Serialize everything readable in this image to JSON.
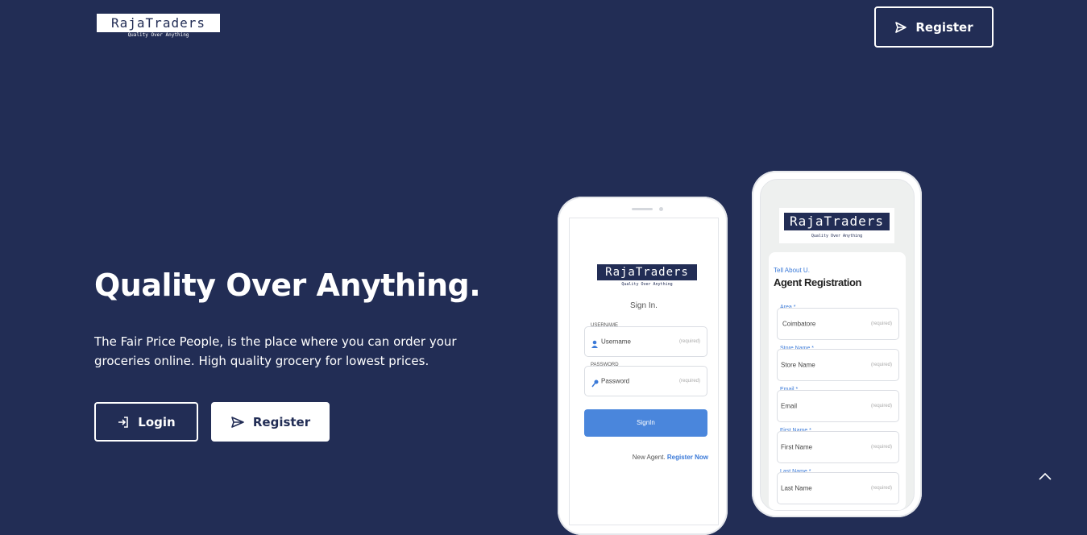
{
  "header": {
    "logo_word": "RajaTraders",
    "logo_tagline": "Quality Over Anything",
    "register_label": "Register"
  },
  "hero": {
    "title": "Quality Over Anything.",
    "description": "The Fair Price People, is the place where you can order your groceries online. High quality grocery for lowest prices.",
    "login_label": "Login",
    "register_label": "Register"
  },
  "phone_signin": {
    "logo_word": "RajaTraders",
    "logo_tagline": "Quality Over Anything",
    "heading": "Sign In.",
    "username_label": "USERNAME",
    "username_placeholder": "Username",
    "password_label": "PASSWORD",
    "password_placeholder": "Password",
    "required_hint": "(required)",
    "signin_button": "SignIn",
    "new_agent_text": "New Agent.",
    "register_now_link": "Register Now"
  },
  "phone_register": {
    "logo_word": "RajaTraders",
    "logo_tagline": "Quality Over Anything",
    "subheading": "Tell About U.",
    "heading": "Agent Registration",
    "required_hint": "(required)",
    "fields": [
      {
        "label": "Area *",
        "value": "Coimbatore"
      },
      {
        "label": "Store Name *",
        "value": "Store Name"
      },
      {
        "label": "Email *",
        "value": "Email"
      },
      {
        "label": "First Name *",
        "value": "First Name"
      },
      {
        "label": "Last Name *",
        "value": "Last Name"
      }
    ]
  },
  "colors": {
    "background": "#222d55",
    "accent_blue": "#3b7ad8",
    "button_text": "#222d55"
  },
  "icons": [
    "send-icon",
    "login-icon",
    "chevron-up-icon",
    "user-icon",
    "key-icon"
  ]
}
